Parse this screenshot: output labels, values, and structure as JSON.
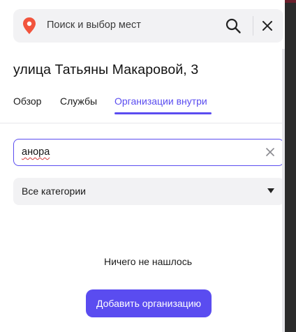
{
  "search": {
    "placeholder": "Поиск и выбор мест",
    "icons": {
      "pin": "map-pin-icon",
      "search": "search-icon",
      "close": "close-icon"
    },
    "pin_color": "#f2543d"
  },
  "place": {
    "address": "улица Татьяны Макаровой, 3"
  },
  "tabs": [
    {
      "label": "Обзор",
      "active": false
    },
    {
      "label": "Службы",
      "active": false
    },
    {
      "label": "Организации внутри",
      "active": true
    }
  ],
  "filter": {
    "query": "анора",
    "category": "Все категории"
  },
  "results": {
    "empty_message": "Ничего не нашлось",
    "add_button_label": "Добавить организацию"
  },
  "colors": {
    "accent": "#5a4cf0",
    "field_bg": "#f2f2f4"
  }
}
